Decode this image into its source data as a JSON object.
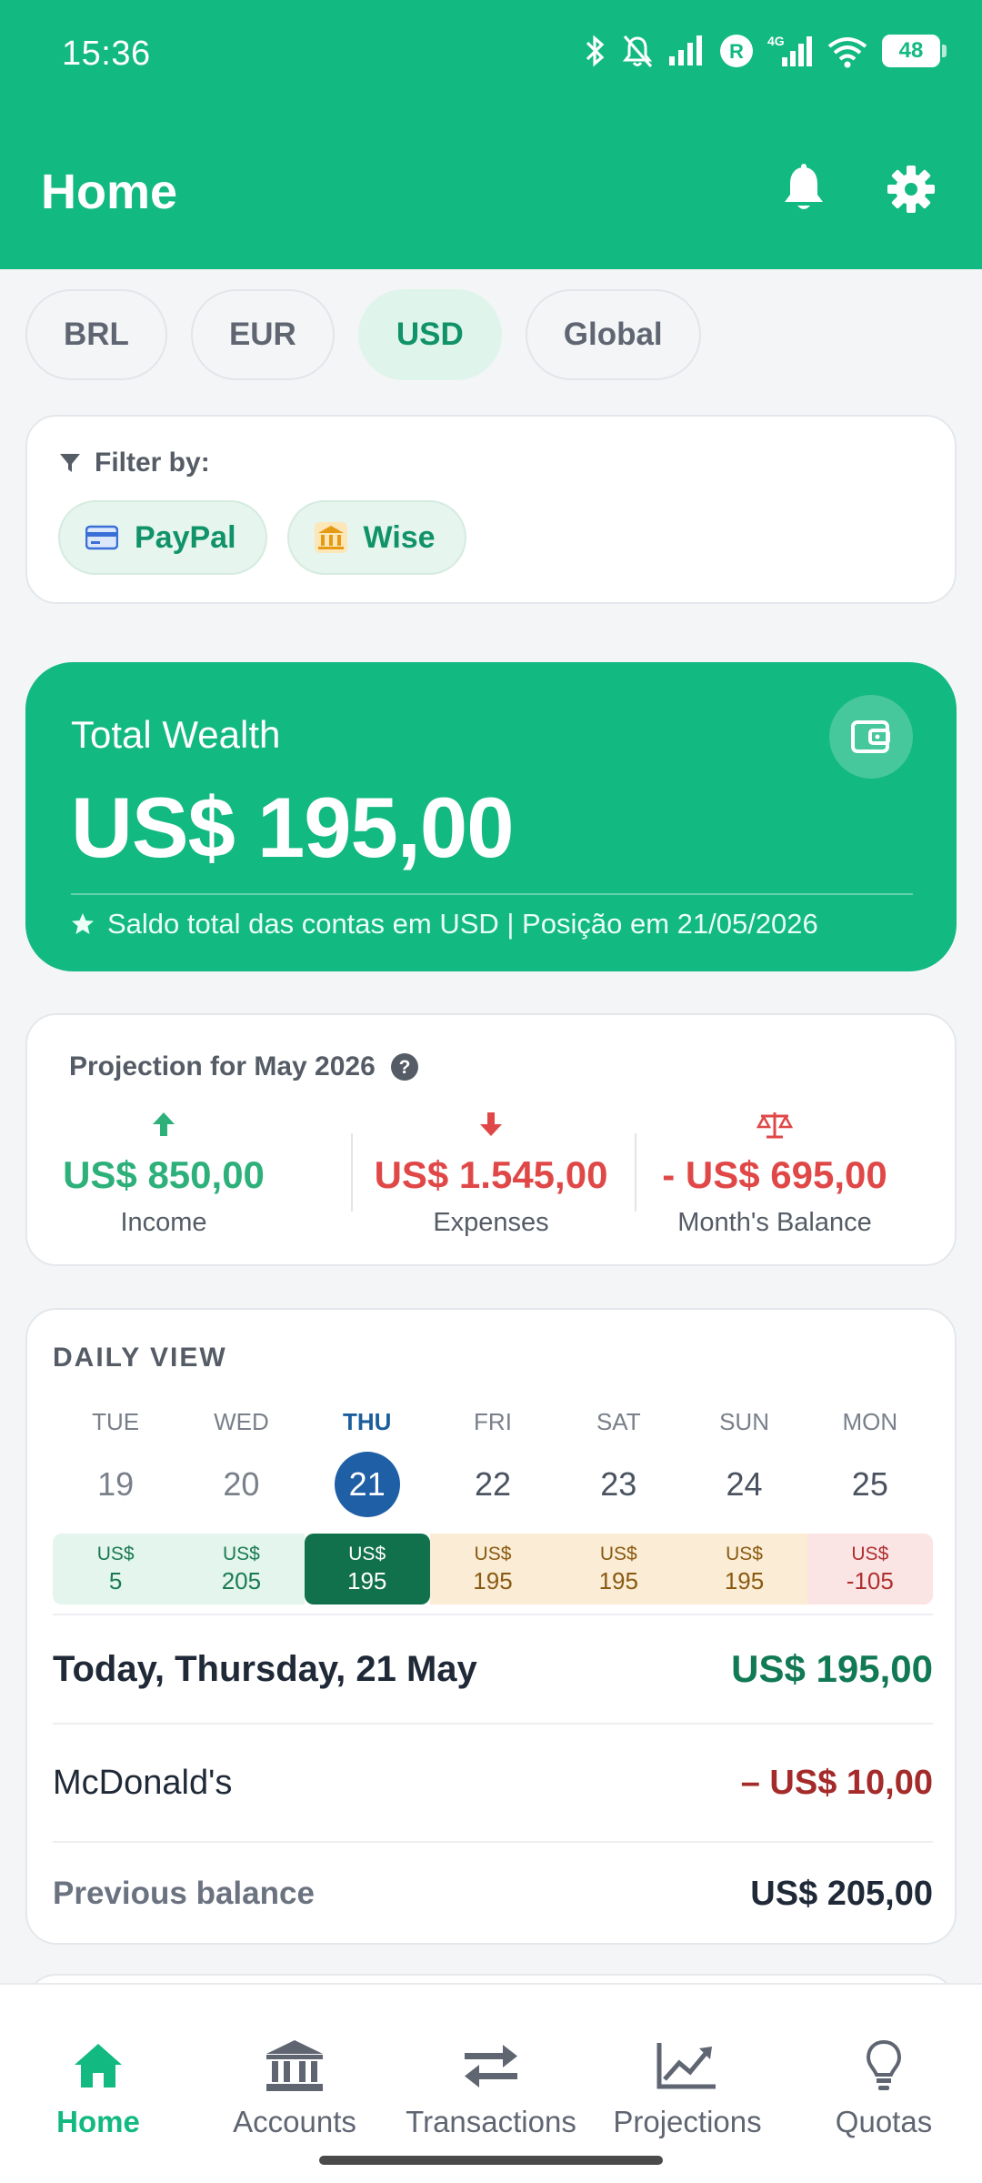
{
  "status_bar": {
    "time": "15:36",
    "battery": "48"
  },
  "header": {
    "title": "Home",
    "bell_icon": "bell-icon",
    "settings_icon": "gear-icon"
  },
  "currency_tabs": [
    {
      "label": "BRL",
      "active": false
    },
    {
      "label": "EUR",
      "active": false
    },
    {
      "label": "USD",
      "active": true
    },
    {
      "label": "Global",
      "active": false
    }
  ],
  "filter": {
    "label": "Filter by:",
    "chips": [
      {
        "label": "PayPal",
        "icon": "credit-card-icon"
      },
      {
        "label": "Wise",
        "icon": "bank-icon"
      }
    ]
  },
  "wealth": {
    "label": "Total Wealth",
    "amount": "US$ 195,00",
    "note": "Saldo total das contas em USD | Posição em 21/05/2026"
  },
  "projection": {
    "title": "Projection for May 2026",
    "income": {
      "amount": "US$ 850,00",
      "label": "Income"
    },
    "expenses": {
      "amount": "US$ 1.545,00",
      "label": "Expenses"
    },
    "balance": {
      "amount": "- US$ 695,00",
      "label": "Month's Balance"
    }
  },
  "daily_view": {
    "title": "DAILY VIEW",
    "days": [
      {
        "dow": "TUE",
        "num": "19",
        "cur": "US$",
        "bal": "5",
        "state": "pos"
      },
      {
        "dow": "WED",
        "num": "20",
        "cur": "US$",
        "bal": "205",
        "state": "pos"
      },
      {
        "dow": "THU",
        "num": "21",
        "cur": "US$",
        "bal": "195",
        "state": "today"
      },
      {
        "dow": "FRI",
        "num": "22",
        "cur": "US$",
        "bal": "195",
        "state": "warn"
      },
      {
        "dow": "SAT",
        "num": "23",
        "cur": "US$",
        "bal": "195",
        "state": "warn"
      },
      {
        "dow": "SUN",
        "num": "24",
        "cur": "US$",
        "bal": "195",
        "state": "warn"
      },
      {
        "dow": "MON",
        "num": "25",
        "cur": "US$",
        "bal": "-105",
        "state": "neg"
      }
    ],
    "today_label": "Today, Thursday, 21 May",
    "today_amount": "US$ 195,00",
    "transaction": {
      "name": "McDonald's",
      "amount": "– US$ 10,00"
    },
    "previous": {
      "label": "Previous balance",
      "amount": "US$ 205,00"
    }
  },
  "nav": [
    {
      "label": "Home",
      "icon": "home-icon",
      "active": true
    },
    {
      "label": "Accounts",
      "icon": "bank-icon",
      "active": false
    },
    {
      "label": "Transactions",
      "icon": "transfer-icon",
      "active": false
    },
    {
      "label": "Projections",
      "icon": "chart-line-icon",
      "active": false
    },
    {
      "label": "Quotas",
      "icon": "lightbulb-icon",
      "active": false
    }
  ],
  "colors": {
    "primary": "#12b981",
    "today_marker": "#1f5fa6",
    "expense": "#e04848",
    "income": "#2db07a"
  }
}
